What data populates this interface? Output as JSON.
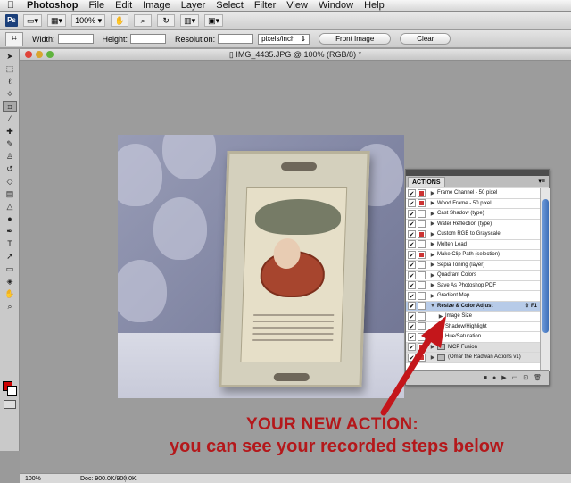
{
  "menubar": {
    "app_name": "Photoshop",
    "items": [
      "File",
      "Edit",
      "Image",
      "Layer",
      "Select",
      "Filter",
      "View",
      "Window",
      "Help"
    ]
  },
  "appbar": {
    "logo": "Ps",
    "zoom": "100%"
  },
  "options": {
    "width_label": "Width:",
    "height_label": "Height:",
    "resolution_label": "Resolution:",
    "units": "pixels/inch",
    "front_image_label": "Front Image",
    "clear_label": "Clear"
  },
  "document": {
    "title": "IMG_4435.JPG @ 100% (RGB/8) *",
    "status_zoom": "100%",
    "status_doc": "Doc: 900.0K/900.0K"
  },
  "actions_panel": {
    "tab": "ACTIONS",
    "rows": [
      {
        "label": "Frame Channel - 50 pixel",
        "type": "action",
        "dlg": "red"
      },
      {
        "label": "Wood Frame - 50 pixel",
        "type": "action",
        "dlg": "red"
      },
      {
        "label": "Cast Shadow (type)",
        "type": "action",
        "dlg": "none"
      },
      {
        "label": "Water Reflection (type)",
        "type": "action",
        "dlg": "none"
      },
      {
        "label": "Custom RGB to Grayscale",
        "type": "action",
        "dlg": "red"
      },
      {
        "label": "Molten Lead",
        "type": "action",
        "dlg": "none"
      },
      {
        "label": "Make Clip Path (selection)",
        "type": "action",
        "dlg": "red"
      },
      {
        "label": "Sepia Toning (layer)",
        "type": "action",
        "dlg": "none"
      },
      {
        "label": "Quadrant Colors",
        "type": "action",
        "dlg": "none"
      },
      {
        "label": "Save As Photoshop PDF",
        "type": "action",
        "dlg": "none"
      },
      {
        "label": "Gradient Map",
        "type": "action",
        "dlg": "none"
      },
      {
        "label": "Resize & Color Adjust",
        "type": "selected",
        "dlg": "none",
        "shortcut": "⇧ F1"
      },
      {
        "label": "Image Size",
        "type": "step",
        "dlg": "none"
      },
      {
        "label": "Shadow/Highlight",
        "type": "step",
        "dlg": "none"
      },
      {
        "label": "Hue/Saturation",
        "type": "step",
        "dlg": "none"
      },
      {
        "label": "MCP Fusion",
        "type": "folder",
        "dlg": "red"
      },
      {
        "label": "(Omar the Radwan Actions v1)",
        "type": "folder",
        "dlg": "red"
      }
    ]
  },
  "annotation": {
    "line1": "YOUR NEW ACTION:",
    "line2": "you can see your recorded steps below",
    "color": "#b4181b"
  }
}
